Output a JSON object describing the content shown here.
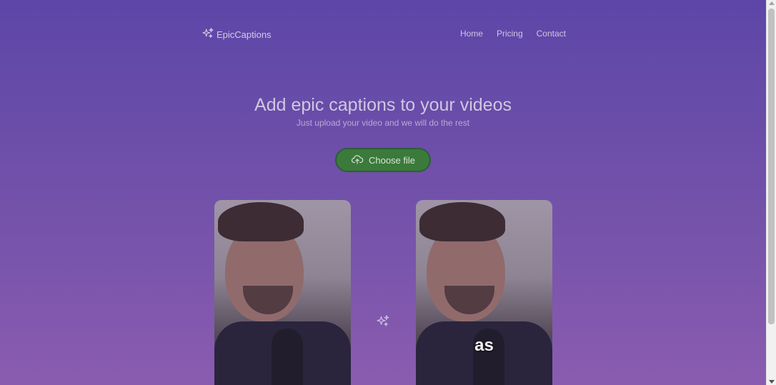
{
  "colors": {
    "background_top": "#5d46a8",
    "background_bottom": "#8a5cb0",
    "button_green": "#3b7a3b",
    "text_light": "#cfc7e0"
  },
  "header": {
    "logo_icon": "sparkles-icon",
    "logo_text": "EpicCaptions",
    "nav": [
      "Home",
      "Pricing",
      "Contact"
    ]
  },
  "hero": {
    "title": "Add epic captions to your videos",
    "subtitle": "Just upload your video and we will do the rest",
    "button_icon": "cloud-upload-icon",
    "button_label": "Choose file"
  },
  "preview": {
    "caption_word": "as",
    "divider_icon": "sparkles-icon"
  }
}
